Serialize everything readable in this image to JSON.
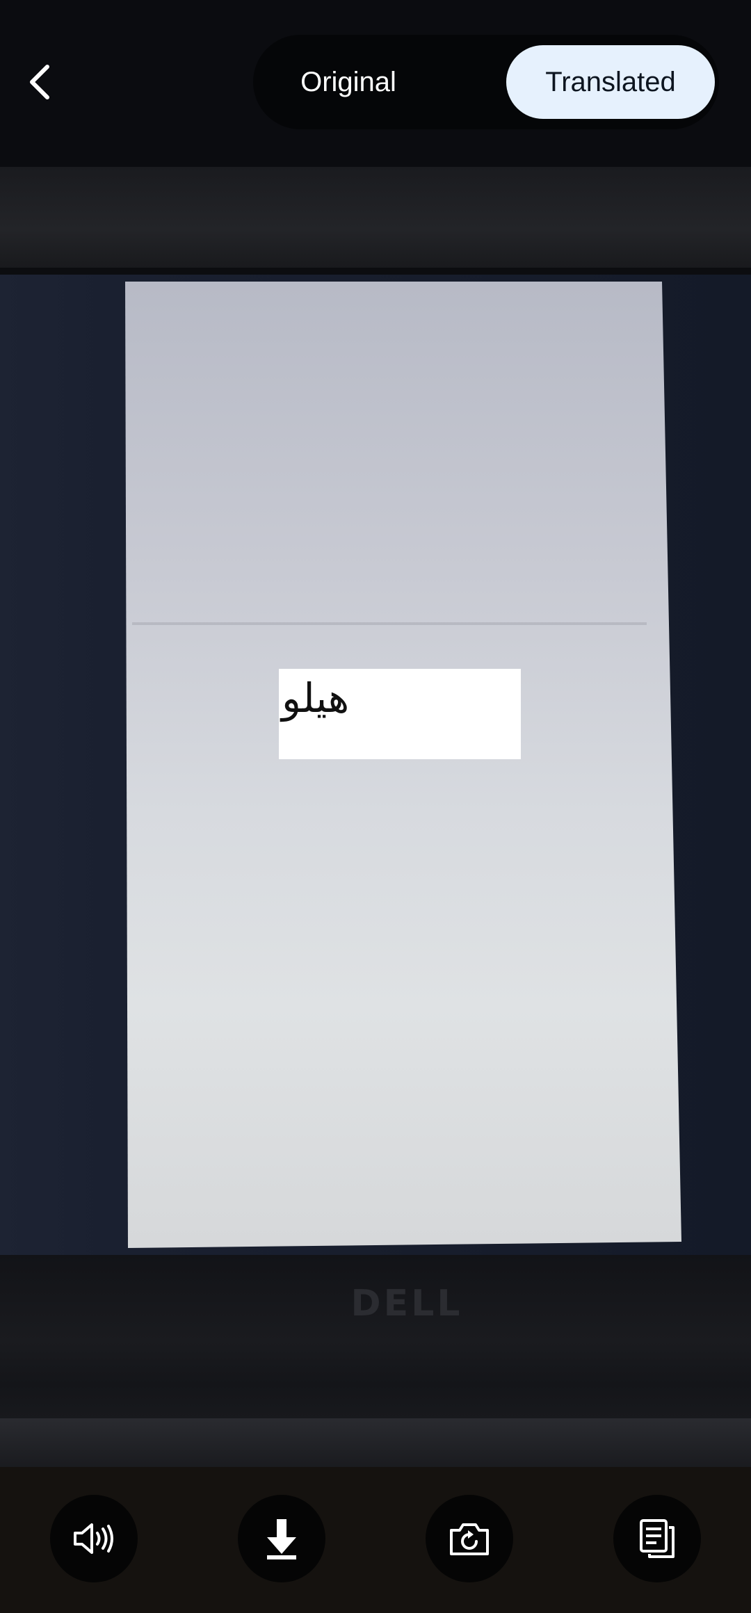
{
  "header": {
    "back_icon": "chevron-left-icon",
    "tabs": [
      {
        "label": "Original",
        "selected": false
      },
      {
        "label": "Translated",
        "selected": true
      }
    ]
  },
  "photo": {
    "translated_text": "هیلو",
    "brand_logo": "DELL"
  },
  "actions": [
    {
      "icon": "speaker-icon"
    },
    {
      "icon": "download-icon"
    },
    {
      "icon": "retake-camera-icon"
    },
    {
      "icon": "copy-text-icon"
    }
  ],
  "colors": {
    "selected_tab_bg": "#e6f1fd",
    "bar_bg": "#0b0c10"
  }
}
